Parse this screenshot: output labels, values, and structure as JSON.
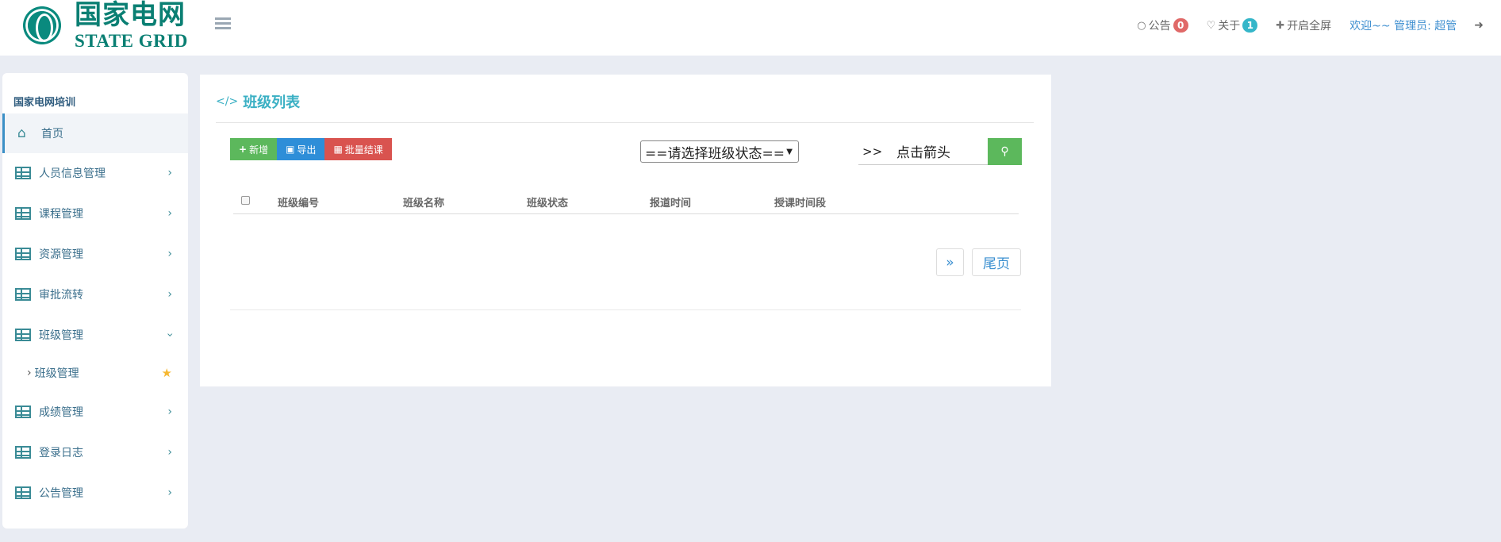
{
  "header": {
    "logo_cn": "国家电网",
    "logo_en": "STATE GRID",
    "notice_label": "公告",
    "notice_count": "0",
    "about_label": "关于",
    "about_count": "1",
    "fullscreen_label": "开启全屏",
    "welcome": "欢迎~~ 管理员: 超管"
  },
  "sidebar": {
    "title": "国家电网培训",
    "items": [
      {
        "label": "首页"
      },
      {
        "label": "人员信息管理"
      },
      {
        "label": "课程管理"
      },
      {
        "label": "资源管理"
      },
      {
        "label": "审批流转"
      },
      {
        "label": "班级管理"
      },
      {
        "label": "成绩管理"
      },
      {
        "label": "登录日志"
      },
      {
        "label": "公告管理"
      }
    ],
    "sub_item": "班级管理"
  },
  "main": {
    "title": "班级列表",
    "buttons": {
      "add": "新增",
      "export": "导出",
      "batch_end": "批量结课"
    },
    "status_select": "==请选择班级状态==",
    "search_prefix": ">>",
    "search_value": "点击箭头",
    "columns": [
      "班级编号",
      "班级名称",
      "班级状态",
      "报道时间",
      "授课时间段"
    ],
    "pager": {
      "next": "»",
      "last": "尾页"
    }
  },
  "colors": {
    "accent": "#3bb0c4",
    "green": "#5cb85c",
    "blue": "#2e8ed8",
    "red": "#d9534f"
  }
}
